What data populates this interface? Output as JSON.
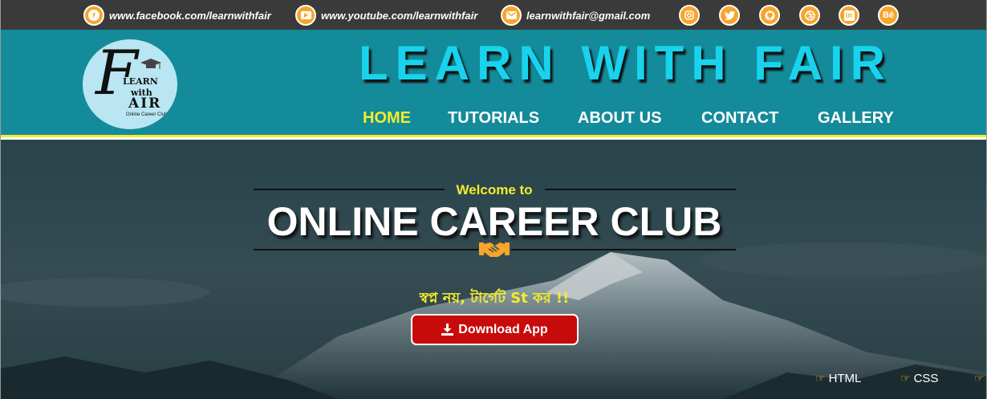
{
  "topbar": {
    "contacts": [
      {
        "icon": "facebook-icon",
        "text": "www.facebook.com/learnwithfair"
      },
      {
        "icon": "youtube-icon",
        "text": "www.youtube.com/learnwithfair"
      },
      {
        "icon": "email-icon",
        "text": "learnwithfair@gmail.com"
      }
    ],
    "social": [
      {
        "icon": "instagram-icon",
        "glyph": "◎"
      },
      {
        "icon": "twitter-icon",
        "glyph": "✦"
      },
      {
        "icon": "github-icon",
        "glyph": "◉"
      },
      {
        "icon": "dribbble-icon",
        "glyph": "⊛"
      },
      {
        "icon": "linkedin-icon",
        "glyph": "in"
      },
      {
        "icon": "behance-icon",
        "glyph": "Bē"
      }
    ],
    "accent": "#f7a52b"
  },
  "logo": {
    "big_letter": "F",
    "learn": "LEARN",
    "with": "with",
    "air": "AIR",
    "tagline": "Online Career Club"
  },
  "header": {
    "title": "LEARN WITH FAIR",
    "nav": [
      "HOME",
      "TUTORIALS",
      "ABOUT US",
      "CONTACT",
      "GALLERY"
    ],
    "active_nav": "HOME",
    "bg": "#138b9a",
    "title_color": "#19d3ee",
    "border": "#f5ec2c"
  },
  "hero": {
    "welcome": "Welcome to",
    "title": "ONLINE CAREER CLUB",
    "tagline": "স্বপ্ন নয়, টার্গেট St কর !!",
    "download_label": "Download App",
    "ticker": [
      "HTML",
      "CSS"
    ]
  }
}
